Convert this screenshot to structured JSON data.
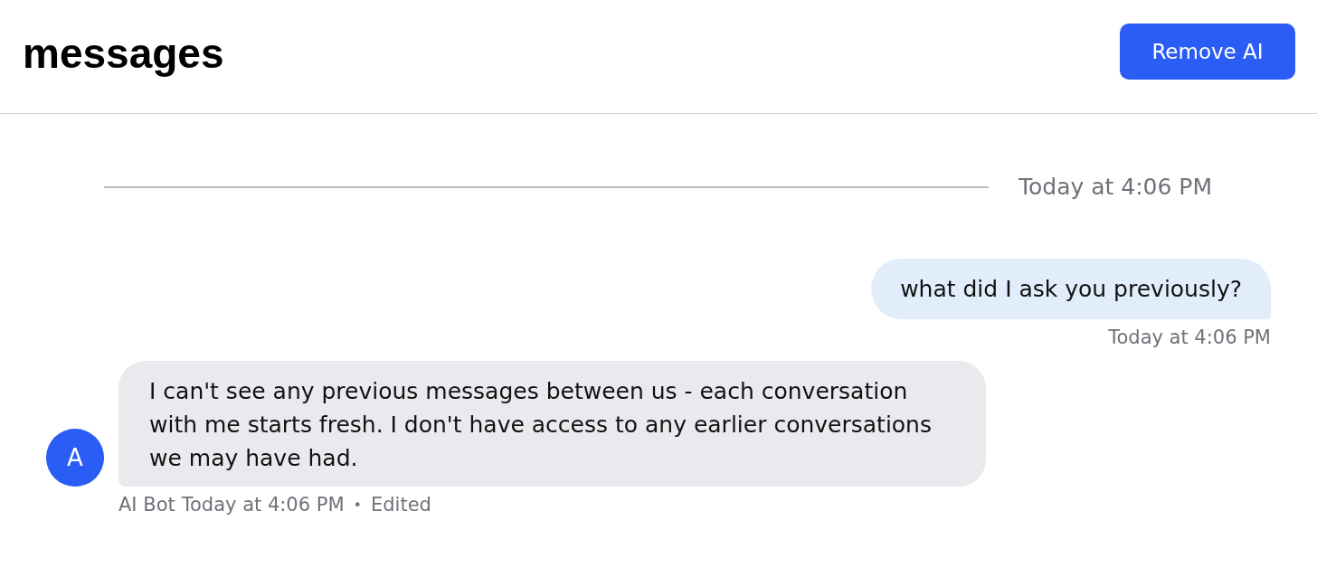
{
  "header": {
    "title": "messages",
    "button": "Remove AI"
  },
  "date_divider": {
    "label": "Today at 4:06 PM"
  },
  "messages": [
    {
      "kind": "outgoing",
      "text": "what did I ask you previously?",
      "time": "Today at 4:06 PM"
    },
    {
      "kind": "incoming",
      "avatar": "A",
      "text": "I can't see any previous messages between us - each conversation with me starts fresh. I don't have access to any earlier conversations we may have had.",
      "sender": "AI Bot",
      "time": "Today at 4:06 PM",
      "separator": "•",
      "edited_label": "Edited"
    }
  ]
}
